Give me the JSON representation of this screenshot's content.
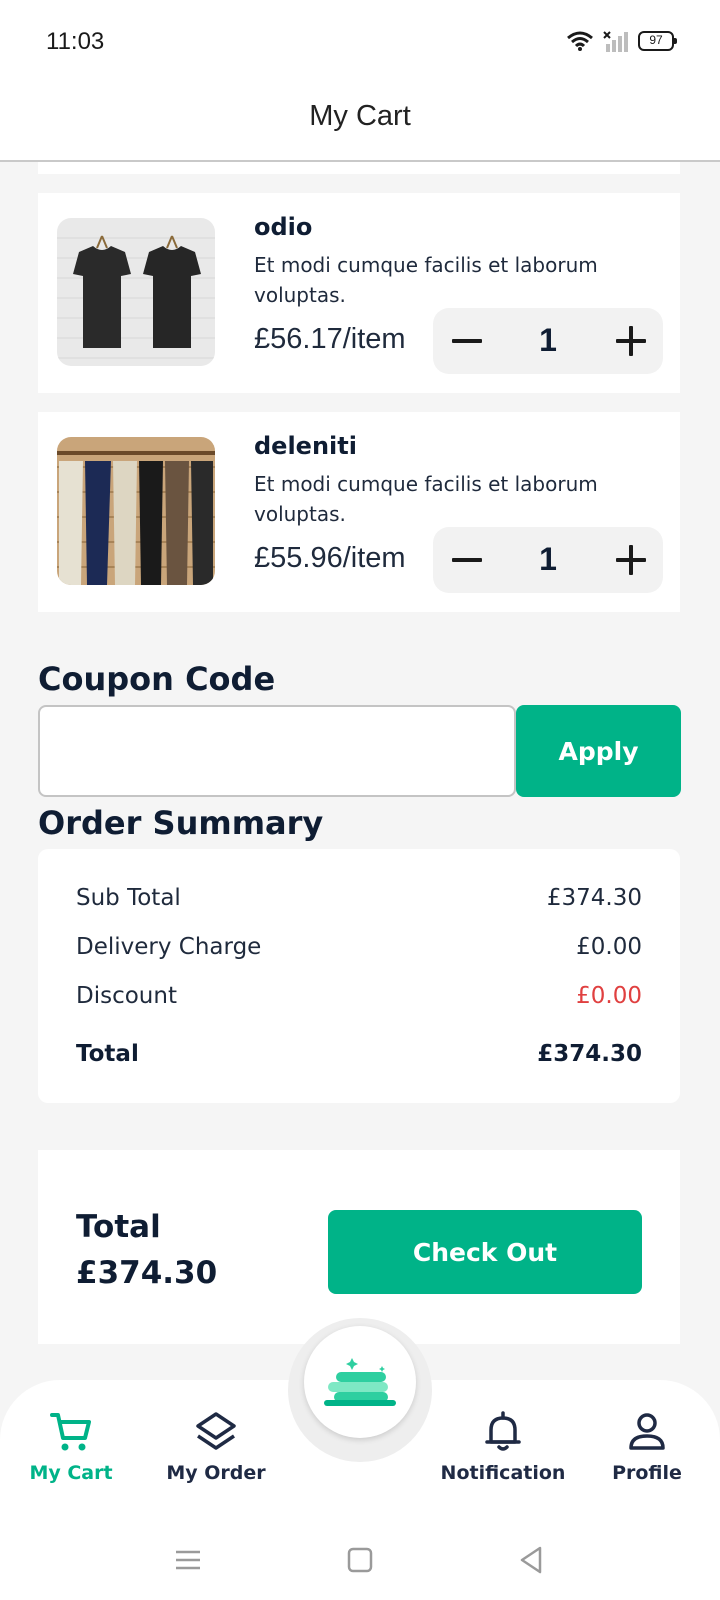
{
  "status_bar": {
    "time": "11:03",
    "battery": "97",
    "icons": [
      "wifi-icon",
      "signal-icon",
      "battery-icon"
    ]
  },
  "app_bar": {
    "title": "My Cart"
  },
  "cart": {
    "items": [
      {
        "name": "odio",
        "description": "Et modi cumque facilis et laborum voluptas.",
        "price": "£56.17/item",
        "quantity": "1",
        "image": "black-tshirts-image"
      },
      {
        "name": "deleniti",
        "description": "Et modi cumque facilis et laborum voluptas.",
        "price": "£55.96/item",
        "quantity": "1",
        "image": "trousers-rack-image"
      }
    ]
  },
  "coupon": {
    "title": "Coupon Code",
    "value": "",
    "apply_label": "Apply"
  },
  "summary": {
    "title": "Order Summary",
    "rows": [
      {
        "label": "Sub Total",
        "value": "£374.30"
      },
      {
        "label": "Delivery Charge",
        "value": "£0.00"
      },
      {
        "label": "Discount",
        "value": "£0.00"
      },
      {
        "label": "Total",
        "value": "£374.30"
      }
    ]
  },
  "checkout": {
    "total_label": "Total",
    "total_value": "£374.30",
    "button_label": "Check Out"
  },
  "bottom_nav": {
    "items": [
      {
        "label": "My Cart",
        "icon": "cart-icon",
        "active": true
      },
      {
        "label": "My Order",
        "icon": "layers-icon",
        "active": false
      },
      {
        "label": "Notification",
        "icon": "bell-icon",
        "active": false
      },
      {
        "label": "Profile",
        "icon": "person-icon",
        "active": false
      }
    ],
    "center_icon": "laundry-stack-icon"
  },
  "colors": {
    "accent": "#00b388",
    "text_dark": "#0f1d33",
    "discount": "#e04040",
    "background": "#f5f5f5"
  }
}
